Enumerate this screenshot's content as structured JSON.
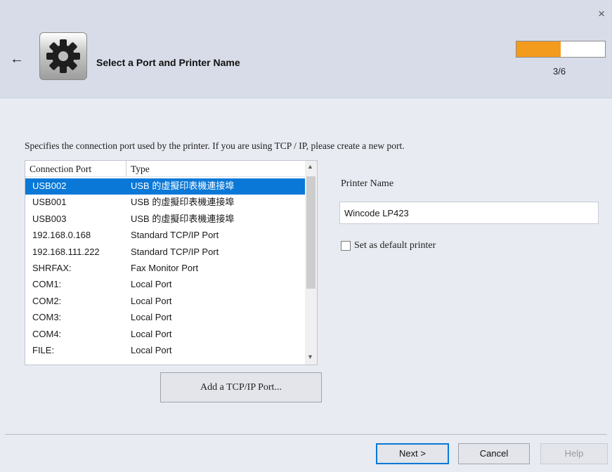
{
  "header": {
    "title": "Select a Port and Printer Name",
    "step": "3/6",
    "progress": 0.5,
    "close_icon": "×",
    "back_icon": "←"
  },
  "description": "Specifies the connection port used by the printer. If you are using TCP / IP, please create a new port.",
  "ports": {
    "headers": [
      "Connection Port",
      "Type"
    ],
    "rows": [
      [
        "USB002",
        "USB 的虛擬印表機連接埠"
      ],
      [
        "USB001",
        "USB 的虛擬印表機連接埠"
      ],
      [
        "USB003",
        "USB 的虛擬印表機連接埠"
      ],
      [
        "192.168.0.168",
        "Standard TCP/IP Port"
      ],
      [
        "192.168.111.222",
        "Standard TCP/IP Port"
      ],
      [
        "SHRFAX:",
        "Fax Monitor Port"
      ],
      [
        "COM1:",
        "Local Port"
      ],
      [
        "COM2:",
        "Local Port"
      ],
      [
        "COM3:",
        "Local Port"
      ],
      [
        "COM4:",
        "Local Port"
      ],
      [
        "FILE:",
        "Local Port"
      ]
    ],
    "selected_index": 0
  },
  "add_port_label": "Add a TCP/IP Port...",
  "printer": {
    "label": "Printer Name",
    "value": "Wincode LP423",
    "default_label": "Set as default printer",
    "default_checked": false
  },
  "footer": {
    "next_label": "Next >",
    "cancel_label": "Cancel",
    "help_label": "Help"
  },
  "colors": {
    "accent": "#0a78d7",
    "progress": "#f29b1d"
  }
}
